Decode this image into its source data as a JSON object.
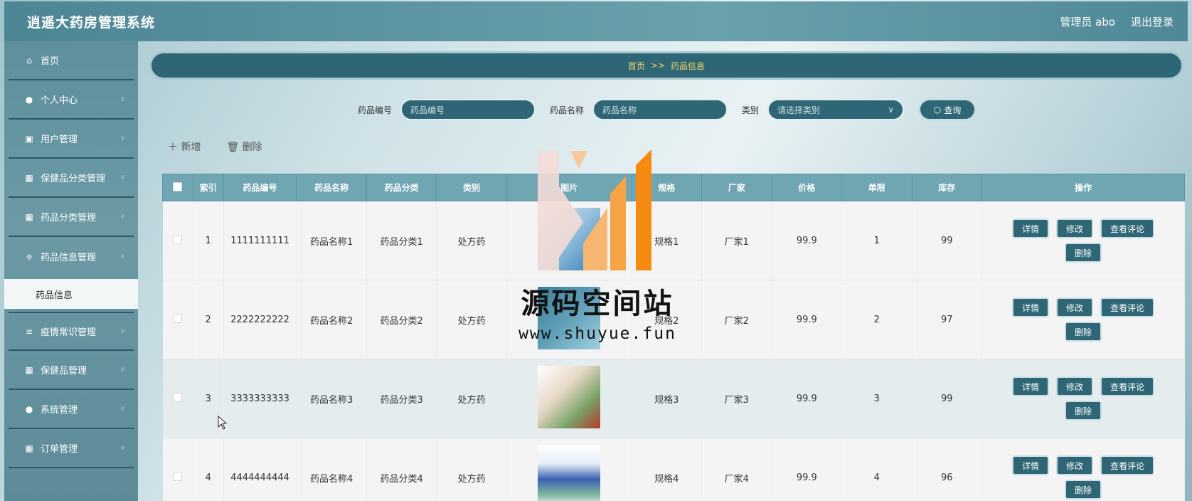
{
  "app": {
    "title": "逍遥大药房管理系统"
  },
  "header": {
    "user": "管理员 abo",
    "logout": "退出登录"
  },
  "sidebar": {
    "items": [
      {
        "label": "首页",
        "icon": "home-icon"
      },
      {
        "label": "个人中心",
        "icon": "user-icon"
      },
      {
        "label": "用户管理",
        "icon": "id-card-icon"
      },
      {
        "label": "保健品分类管理",
        "icon": "grid-icon"
      },
      {
        "label": "药品分类管理",
        "icon": "grid-icon"
      },
      {
        "label": "药品信息管理",
        "icon": "sliders-icon"
      },
      {
        "label": "疫情常识管理",
        "icon": "list-icon"
      },
      {
        "label": "保健品管理",
        "icon": "grid-icon"
      },
      {
        "label": "系统管理",
        "icon": "pin-icon"
      },
      {
        "label": "订单管理",
        "icon": "grid-icon"
      }
    ],
    "active_sub": "药品信息"
  },
  "breadcrumb": {
    "home": "首页",
    "sep": ">>",
    "current": "药品信息"
  },
  "search": {
    "code_label": "药品编号",
    "code_placeholder": "药品编号",
    "name_label": "药品名称",
    "name_placeholder": "药品名称",
    "type_label": "类别",
    "type_placeholder": "请选择类别",
    "query": "查询"
  },
  "toolbar": {
    "add": "新增",
    "delete": "删除"
  },
  "table": {
    "columns": [
      "索引",
      "药品编号",
      "药品名称",
      "药品分类",
      "类别",
      "图片",
      "规格",
      "厂家",
      "价格",
      "单限",
      "库存",
      "操作"
    ],
    "rows": [
      {
        "index": "1",
        "code": "1111111111",
        "name": "药品名称1",
        "category": "药品分类1",
        "type": "处方药",
        "spec": "规格1",
        "maker": "厂家1",
        "price": "99.9",
        "limit": "1",
        "stock": "99"
      },
      {
        "index": "2",
        "code": "2222222222",
        "name": "药品名称2",
        "category": "药品分类2",
        "type": "处方药",
        "spec": "规格2",
        "maker": "厂家2",
        "price": "99.9",
        "limit": "2",
        "stock": "97"
      },
      {
        "index": "3",
        "code": "3333333333",
        "name": "药品名称3",
        "category": "药品分类3",
        "type": "处方药",
        "spec": "规格3",
        "maker": "厂家3",
        "price": "99.9",
        "limit": "3",
        "stock": "99"
      },
      {
        "index": "4",
        "code": "4444444444",
        "name": "药品名称4",
        "category": "药品分类4",
        "type": "处方药",
        "spec": "规格4",
        "maker": "厂家4",
        "price": "99.9",
        "limit": "4",
        "stock": "96"
      }
    ],
    "ops": {
      "detail": "详情",
      "edit": "修改",
      "comments": "查看评论",
      "delete": "删除"
    }
  },
  "watermark": {
    "title": "源码空间站",
    "url": "www.shuyue.fun"
  },
  "colors": {
    "primary": "#2e6675",
    "header_bg": "#5f97a4",
    "accent": "#f1d46a"
  }
}
